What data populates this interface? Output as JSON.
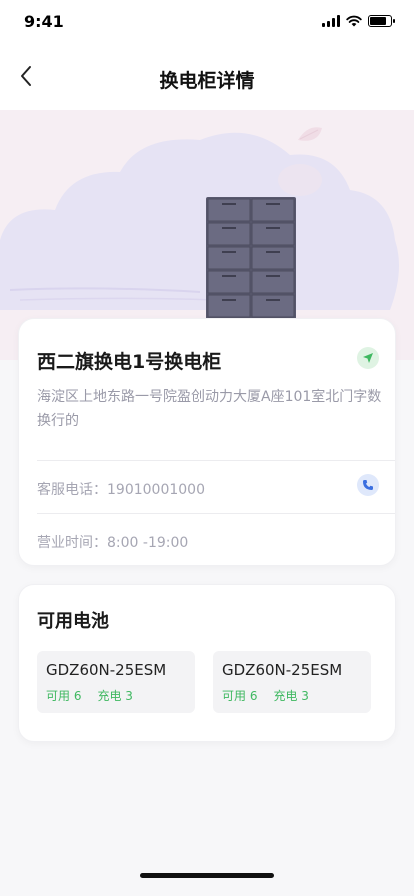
{
  "status_bar": {
    "time": "9:41"
  },
  "nav": {
    "title": "换电柜详情"
  },
  "station": {
    "name": "西二旗换电1号换电柜",
    "address": "海淀区上地东路一号院盈创动力大厦A座101室北门字数换行的",
    "phone_label": "客服电话：",
    "phone_value": "19010001000",
    "hours_label": "营业时间：",
    "hours_value": "8:00 -19:00"
  },
  "batteries": {
    "title": "可用电池",
    "items": [
      {
        "model": "GDZ60N-25ESM",
        "available": "可用 6",
        "charging": "充电 3"
      },
      {
        "model": "GDZ60N-25ESM",
        "available": "可用 6",
        "charging": "充电 3"
      }
    ]
  },
  "colors": {
    "accent_green": "#3fb861",
    "phone_blue": "#3b6fe0",
    "hero_bg": "#f6eef3",
    "cloud": "#e6e3f4"
  },
  "icons": {
    "back": "chevron-left-icon",
    "navigate": "location-arrow-icon",
    "phone": "phone-icon"
  }
}
